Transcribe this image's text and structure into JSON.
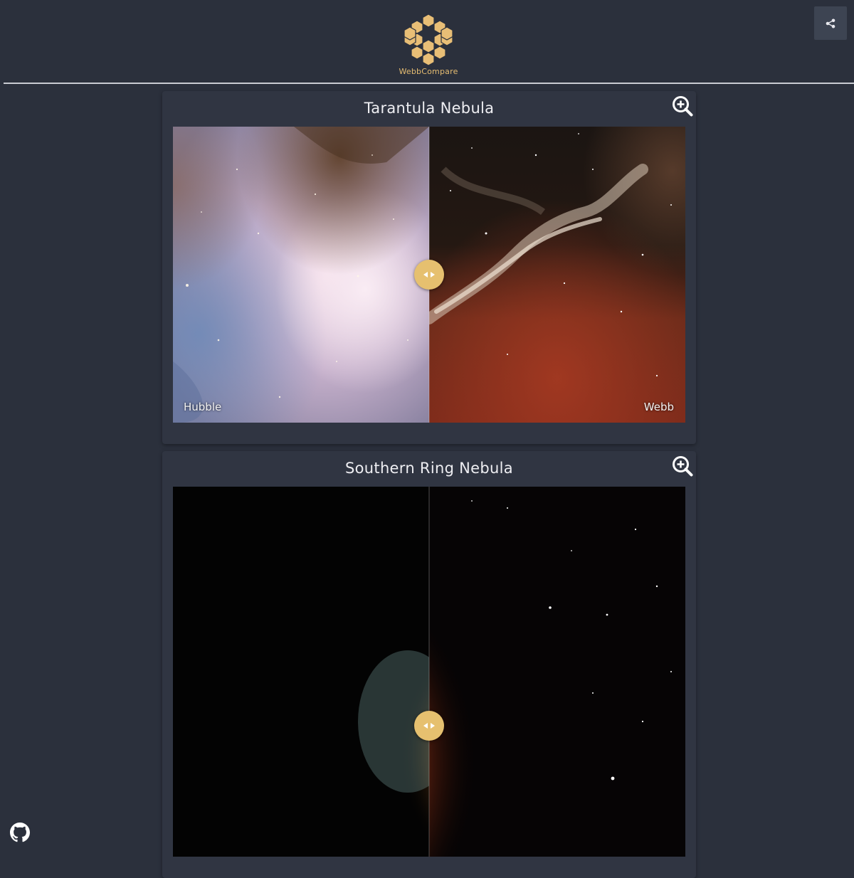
{
  "app": {
    "name": "WebbCompare"
  },
  "icons": {
    "logo": "webb-mirror-logo-icon",
    "share": "share-icon",
    "zoom": "zoom-in-icon",
    "handle": "left-right-arrows-icon",
    "github": "github-icon"
  },
  "colors": {
    "background": "#2b303c",
    "card": "#303542",
    "accent": "#e6c06f",
    "logo_text": "#e6bd72"
  },
  "comparisons": [
    {
      "title": "Tarantula Nebula",
      "left_label": "Hubble",
      "right_label": "Webb"
    },
    {
      "title": "Southern Ring Nebula"
    }
  ]
}
